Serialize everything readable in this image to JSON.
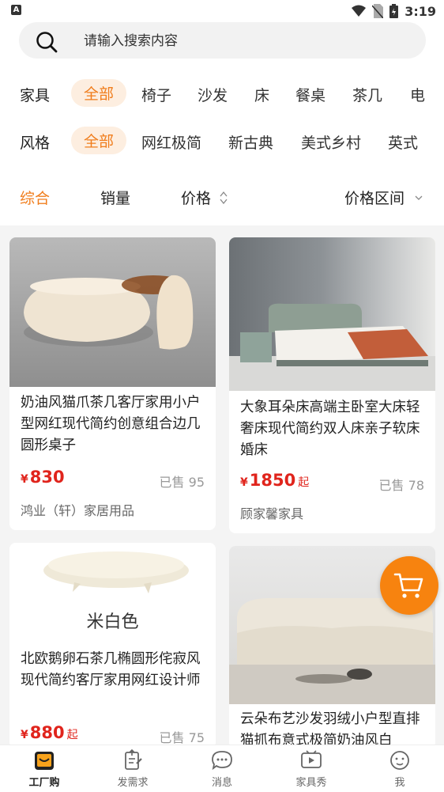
{
  "status_bar": {
    "indicator": "A",
    "time": "3:19"
  },
  "search": {
    "placeholder": "请输入搜索内容"
  },
  "furniture_filter": {
    "label": "家具",
    "chips": [
      "全部",
      "椅子",
      "沙发",
      "床",
      "餐桌",
      "茶几",
      "电"
    ]
  },
  "style_filter": {
    "label": "风格",
    "chips": [
      "全部",
      "网红极简",
      "新古典",
      "美式乡村",
      "英式"
    ]
  },
  "sort_bar": {
    "comprehensive": "综合",
    "sales": "销量",
    "price": "价格",
    "price_range": "价格区间"
  },
  "products": [
    {
      "title": "奶油风猫爪茶几客厅家用小户型网红现代简约创意组合边几圆形桌子",
      "currency": "¥",
      "price": "830",
      "suffix": "",
      "sold": "已售 95",
      "shop": "鸿业（轩）家居用品"
    },
    {
      "title": "大象耳朵床高端主卧室大床轻奢床现代简约双人床亲子软床婚床",
      "currency": "¥",
      "price": "1850",
      "suffix": "起",
      "sold": "已售 78",
      "shop": "顾家馨家具"
    },
    {
      "title": "北欧鹅卵石茶几椭圆形侘寂风现代简约客厅家用网红设计师",
      "image_caption": "米白色",
      "currency": "¥",
      "price": "880",
      "suffix": "起",
      "sold": "已售 75",
      "shop": ""
    },
    {
      "title": "云朵布艺沙发羽绒小户型直排猫抓布意式极简奶油风白",
      "currency": "¥",
      "price": "",
      "suffix": "",
      "sold": "",
      "shop": ""
    }
  ],
  "tab_bar": {
    "items": [
      {
        "label": "工厂购",
        "icon": "factory-bag-icon",
        "active": true
      },
      {
        "label": "发需求",
        "icon": "post-request-icon",
        "active": false
      },
      {
        "label": "消息",
        "icon": "message-icon",
        "active": false
      },
      {
        "label": "家具秀",
        "icon": "video-icon",
        "active": false
      },
      {
        "label": "我",
        "icon": "profile-icon",
        "active": false
      }
    ]
  },
  "colors": {
    "accent": "#f07d1c",
    "price_red": "#e0241c",
    "fab": "#f7830f"
  }
}
